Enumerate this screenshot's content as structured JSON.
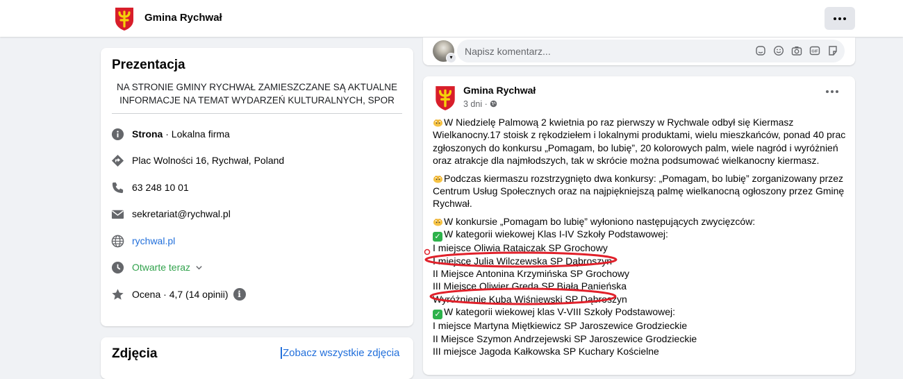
{
  "header": {
    "page_name": "Gmina Rychwał",
    "logo_icon": "gmina-rychwal-coat-of-arms",
    "more_icon": "more-dots-icon"
  },
  "intro": {
    "title": "Prezentacja",
    "description_lines": [
      "NA STRONIE GMINY RYCHWAŁ ZAMIESZCZANE SĄ AKTUALNE",
      "INFORMACJE NA TEMAT WYDARZEŃ KULTURALNYCH, SPOR"
    ],
    "page_type_bold": "Strona",
    "page_type_rest": " · Lokalna firma",
    "address": "Plac Wolności 16, Rychwał, Poland",
    "phone": "63 248 10 01",
    "email": "sekretariat@rychwal.pl",
    "website": "rychwal.pl",
    "hours": "Otwarte teraz",
    "rating": "Ocena · 4,7 (14 opinii)"
  },
  "photos": {
    "title": "Zdjęcia",
    "see_all": "Zobacz wszystkie zdjęcia"
  },
  "comment": {
    "placeholder": "Napisz komentarz..."
  },
  "post": {
    "author": "Gmina Rychwał",
    "time": "3 dni ·",
    "paragraphs": [
      [
        "W Niedzielę Palmową 2 kwietnia po raz pierwszy w Rychwale odbył się Kiermasz",
        "Wielkanocny.17 stoisk z rękodziełem i lokalnymi produktami, wielu mieszkańców, ponad 40 prac",
        "zgłoszonych do konkursu „Pomagam, bo lubię”, 20 kolorowych palm, wiele nagród i wyróżnień",
        "oraz atrakcje dla najmłodszych, tak w skrócie można podsumować wielkanocny kiermasz."
      ],
      [
        "Podczas kiermaszu rozstrzygnięto dwa konkursy: „Pomagam, bo lubię” zorganizowany przez",
        "Centrum Usług Społecznych oraz na najpiękniejszą palmę wielkanocną ogłoszony przez Gminę",
        "Rychwał."
      ]
    ],
    "results": [
      "W konkursie „Pomagam bo lubię” wyłoniono następujących zwycięzców:",
      "W kategorii wiekowej Klas I-IV Szkoły Podstawowej:",
      "I miejsce Oliwia Ratajczak SP Grochowy",
      "I miejsce Julia Wilczewska SP Dąbroszyn",
      "II Miejsce Antonina Krzymińska SP Grochowy",
      "III Miejsce Oliwier Greda SP Biała Panieńska",
      "Wyróżnienie Kuba Wiśniewski SP Dąbroszyn",
      "W kategorii wiekowej klas V-VIII Szkoły Podstawowej:",
      "I miejsce Martyna Miętkiewicz SP Jaroszewice Grodzieckie",
      "II Miejsce Szymon Andrzejewski SP Jaroszewice Grodzieckie",
      "III miejsce Jagoda Kałkowska SP Kuchary Kościelne"
    ]
  },
  "colors": {
    "link": "#216fdb",
    "open_now": "#31a24c",
    "annotation": "#e0202a"
  }
}
